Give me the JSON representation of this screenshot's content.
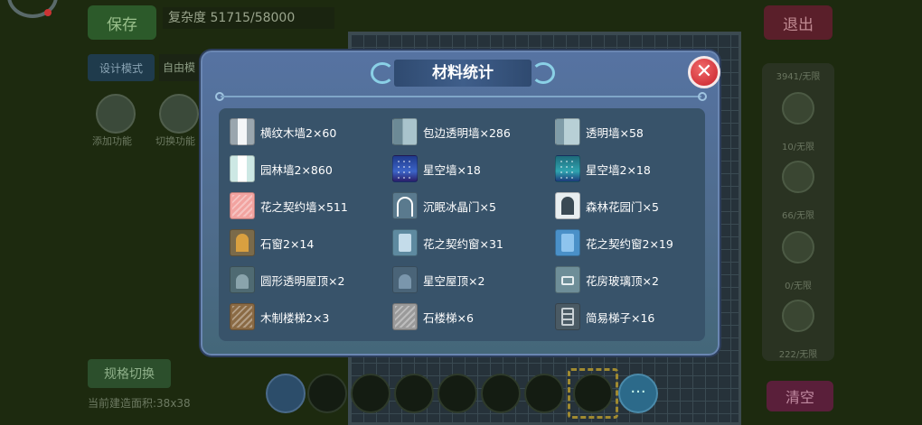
{
  "background": {
    "save_label": "保存",
    "complexity_text": "复杂度 51715/58000",
    "exit_label": "退出",
    "design_label": "设计模式",
    "free_mode_label": "自由模",
    "round_labels": [
      "添加功能",
      "切换功能"
    ],
    "spec_switch_label": "规格切换",
    "area_text": "当前建造面积:38x38",
    "clear_label": "清空",
    "right_panel_labels": [
      "3941/无限",
      "10/无限",
      "66/无限",
      "0/无限",
      "222/无限"
    ]
  },
  "dialog": {
    "title": "材料统计",
    "close_glyph": "✕",
    "items": [
      {
        "label": "横纹木墙2×60",
        "icon": "wood-wall-icon"
      },
      {
        "label": "包边透明墙×286",
        "icon": "glass-edge-wall-icon"
      },
      {
        "label": "透明墙×58",
        "icon": "glass-wall-icon"
      },
      {
        "label": "园林墙2×860",
        "icon": "garden-wall-icon"
      },
      {
        "label": "星空墙×18",
        "icon": "starry-wall-icon"
      },
      {
        "label": "星空墙2×18",
        "icon": "starry-wall-2-icon"
      },
      {
        "label": "花之契约墙×511",
        "icon": "flower-wall-icon"
      },
      {
        "label": "沉眠冰晶门×5",
        "icon": "ice-crystal-door-icon"
      },
      {
        "label": "森林花园门×5",
        "icon": "forest-garden-door-icon"
      },
      {
        "label": "石窗2×14",
        "icon": "stone-window-icon"
      },
      {
        "label": "花之契约窗×31",
        "icon": "flower-window-icon"
      },
      {
        "label": "花之契约窗2×19",
        "icon": "flower-window-2-icon"
      },
      {
        "label": "圆形透明屋顶×2",
        "icon": "round-glass-roof-icon"
      },
      {
        "label": "星空屋顶×2",
        "icon": "starry-roof-icon"
      },
      {
        "label": "花房玻璃顶×2",
        "icon": "greenhouse-roof-icon"
      },
      {
        "label": "木制楼梯2×3",
        "icon": "wood-stairs-icon"
      },
      {
        "label": "石楼梯×6",
        "icon": "stone-stairs-icon"
      },
      {
        "label": "简易梯子×16",
        "icon": "simple-ladder-icon"
      }
    ]
  },
  "hotbar": {
    "more_glyph": "···"
  }
}
